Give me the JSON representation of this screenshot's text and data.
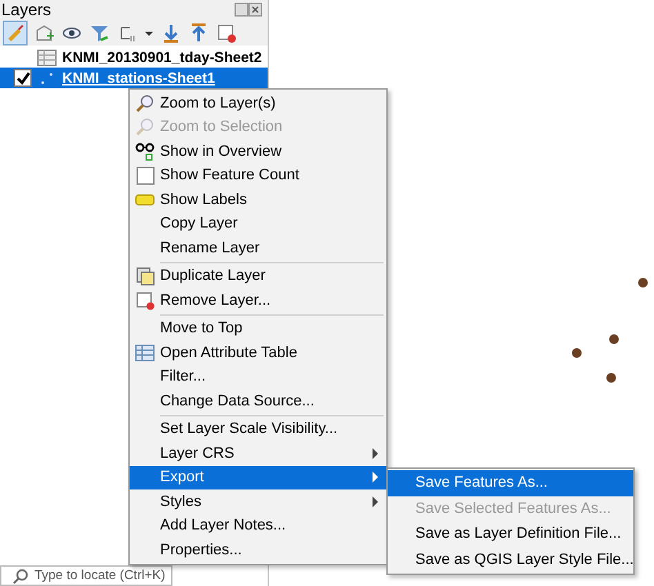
{
  "panel": {
    "title": "Layers"
  },
  "layers": [
    {
      "name": "KNMI_20130901_tday-Sheet2",
      "kind": "table",
      "selected": false,
      "checked": false
    },
    {
      "name": "KNMI_stations-Sheet1",
      "kind": "points",
      "selected": true,
      "checked": true
    }
  ],
  "context_menu": {
    "items": [
      {
        "kind": "item",
        "label": "Zoom to Layer(s)",
        "disabled": false,
        "selected": false,
        "submenu": false
      },
      {
        "kind": "item",
        "label": "Zoom to Selection",
        "disabled": true,
        "selected": false,
        "submenu": false
      },
      {
        "kind": "item",
        "label": "Show in Overview",
        "disabled": false,
        "selected": false,
        "submenu": false
      },
      {
        "kind": "checkbox",
        "label": "Show Feature Count",
        "checked": false,
        "disabled": false,
        "selected": false,
        "submenu": false
      },
      {
        "kind": "item",
        "label": "Show Labels",
        "disabled": false,
        "selected": false,
        "submenu": false
      },
      {
        "kind": "item",
        "label": "Copy Layer",
        "disabled": false,
        "selected": false,
        "submenu": false
      },
      {
        "kind": "item",
        "label": "Rename Layer",
        "disabled": false,
        "selected": false,
        "submenu": false
      },
      {
        "kind": "separator"
      },
      {
        "kind": "item",
        "label": "Duplicate Layer",
        "disabled": false,
        "selected": false,
        "submenu": false
      },
      {
        "kind": "item",
        "label": "Remove Layer...",
        "disabled": false,
        "selected": false,
        "submenu": false
      },
      {
        "kind": "separator"
      },
      {
        "kind": "item",
        "label": "Move to Top",
        "disabled": false,
        "selected": false,
        "submenu": false
      },
      {
        "kind": "item",
        "label": "Open Attribute Table",
        "disabled": false,
        "selected": false,
        "submenu": false
      },
      {
        "kind": "item",
        "label": "Filter...",
        "disabled": false,
        "selected": false,
        "submenu": false
      },
      {
        "kind": "item",
        "label": "Change Data Source...",
        "disabled": false,
        "selected": false,
        "submenu": false
      },
      {
        "kind": "separator"
      },
      {
        "kind": "item",
        "label": "Set Layer Scale Visibility...",
        "disabled": false,
        "selected": false,
        "submenu": false
      },
      {
        "kind": "item",
        "label": "Layer CRS",
        "disabled": false,
        "selected": false,
        "submenu": true
      },
      {
        "kind": "item",
        "label": "Export",
        "disabled": false,
        "selected": true,
        "submenu": true
      },
      {
        "kind": "item",
        "label": "Styles",
        "disabled": false,
        "selected": false,
        "submenu": true
      },
      {
        "kind": "item",
        "label": "Add Layer Notes...",
        "disabled": false,
        "selected": false,
        "submenu": false
      },
      {
        "kind": "item",
        "label": "Properties...",
        "disabled": false,
        "selected": false,
        "submenu": false
      }
    ]
  },
  "submenu": {
    "items": [
      {
        "label": "Save Features As...",
        "disabled": false,
        "selected": true
      },
      {
        "label": "Save Selected Features As...",
        "disabled": true,
        "selected": false
      },
      {
        "label": "Save as Layer Definition File...",
        "disabled": false,
        "selected": false
      },
      {
        "label": "Save as QGIS Layer Style File...",
        "disabled": false,
        "selected": false
      }
    ]
  },
  "locator": {
    "placeholder": "Type to locate (Ctrl+K)"
  }
}
